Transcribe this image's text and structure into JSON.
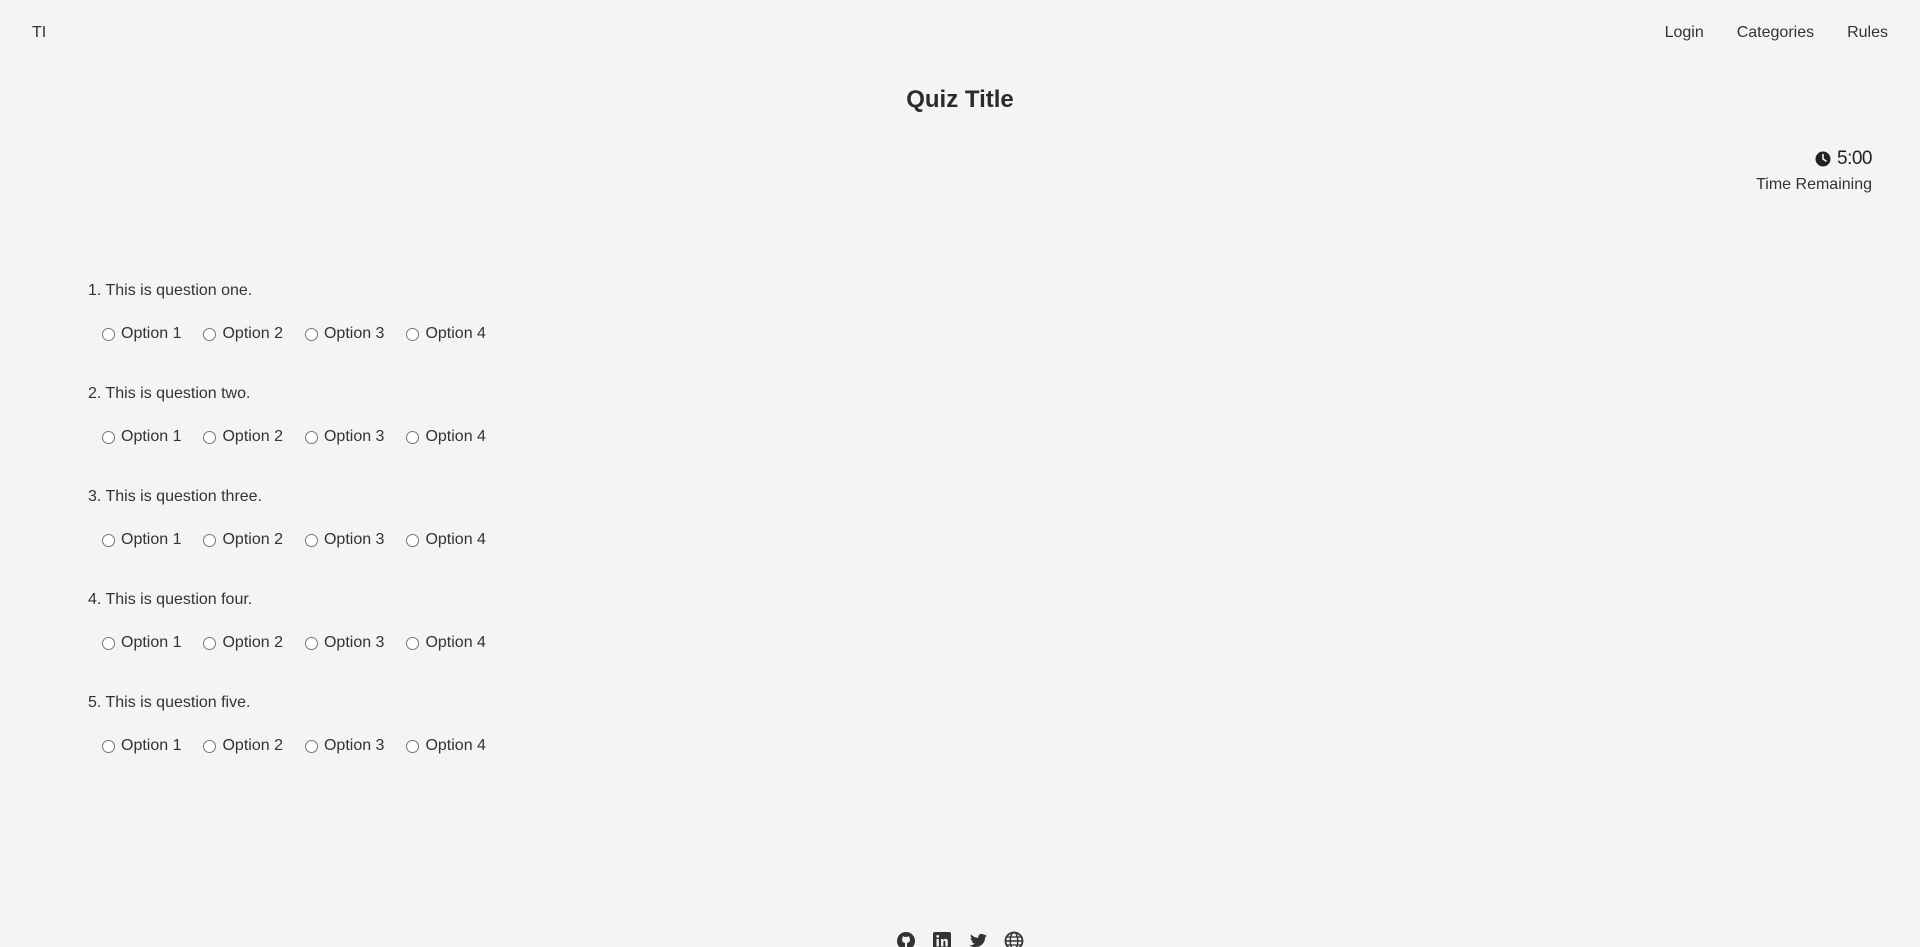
{
  "header": {
    "logo": "TI",
    "nav": [
      {
        "label": "Login"
      },
      {
        "label": "Categories"
      },
      {
        "label": "Rules"
      }
    ]
  },
  "quiz": {
    "title": "Quiz Title",
    "timer": {
      "value": "5:00",
      "caption": "Time Remaining",
      "icon": "clock-icon"
    },
    "questions": [
      {
        "text": "1. This is question one.",
        "options": [
          "Option 1",
          "Option 2",
          "Option 3",
          "Option 4"
        ]
      },
      {
        "text": "2. This is question two.",
        "options": [
          "Option 1",
          "Option 2",
          "Option 3",
          "Option 4"
        ]
      },
      {
        "text": "3. This is question three.",
        "options": [
          "Option 1",
          "Option 2",
          "Option 3",
          "Option 4"
        ]
      },
      {
        "text": "4. This is question four.",
        "options": [
          "Option 1",
          "Option 2",
          "Option 3",
          "Option 4"
        ]
      },
      {
        "text": "5. This is question five.",
        "options": [
          "Option 1",
          "Option 2",
          "Option 3",
          "Option 4"
        ]
      }
    ]
  },
  "footer": {
    "icons": [
      "github-icon",
      "linkedin-icon",
      "twitter-icon",
      "globe-icon"
    ]
  },
  "colors": {
    "background": "#f4f4f4",
    "text": "#333333"
  }
}
